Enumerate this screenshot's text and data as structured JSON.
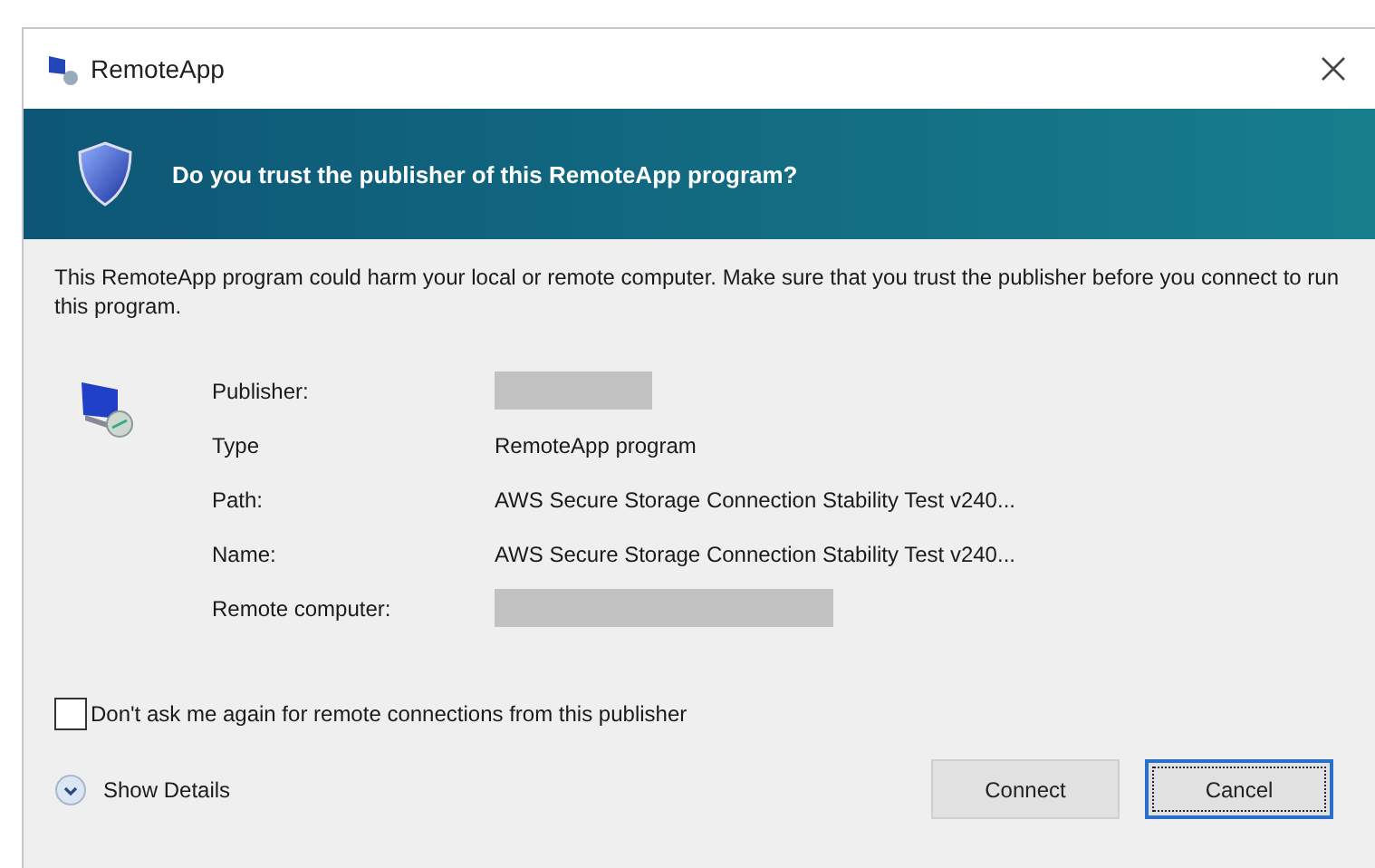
{
  "window": {
    "title": "RemoteApp"
  },
  "banner": {
    "title": "Do you trust the publisher of this RemoteApp program?"
  },
  "message": "This RemoteApp program could harm your local or remote computer. Make sure that you trust the publisher before you connect to run this program.",
  "details": [
    {
      "label": "Publisher:",
      "redacted": true
    },
    {
      "label": "Type",
      "value": "RemoteApp program",
      "redacted": false
    },
    {
      "label": "Path:",
      "value": "AWS Secure Storage Connection Stability Test v240...",
      "redacted": false
    },
    {
      "label": "Name:",
      "value": "AWS Secure Storage Connection Stability Test v240...",
      "redacted": false
    },
    {
      "label": "Remote computer:",
      "redacted": true,
      "wide": true
    }
  ],
  "dont_ask": {
    "label": "Don't ask me again for remote connections from this publisher",
    "checked": false
  },
  "show_details": {
    "label": "Show Details",
    "expanded": false
  },
  "buttons": [
    {
      "label": "Connect",
      "focused": false
    },
    {
      "label": "Cancel",
      "focused": true
    }
  ]
}
